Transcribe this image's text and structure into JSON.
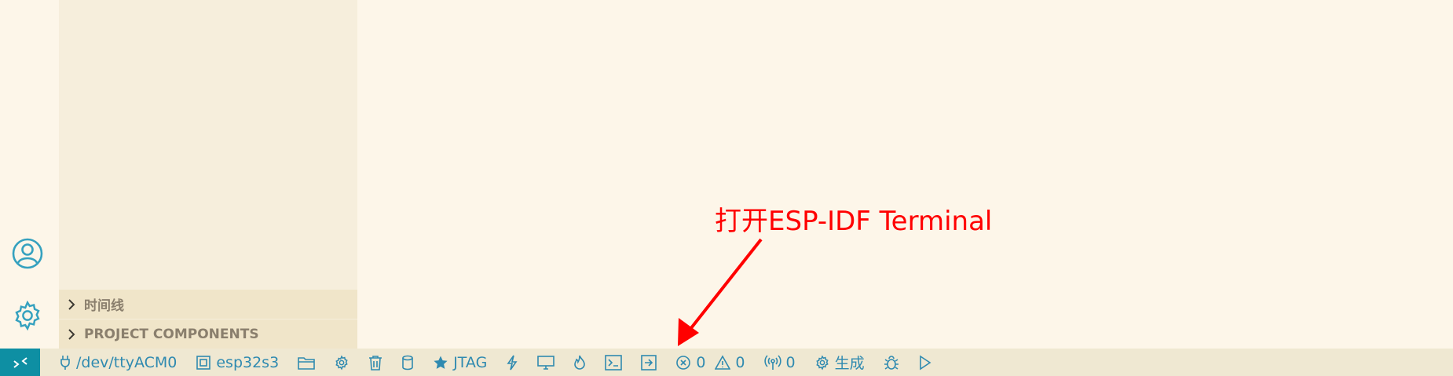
{
  "sidebar": {
    "sections": [
      {
        "label": "时间线",
        "icon": "chevron-right-icon"
      },
      {
        "label": "PROJECT COMPONENTS",
        "icon": "chevron-right-icon"
      }
    ]
  },
  "activity_bar": {
    "icons": [
      "account-icon",
      "gear-icon"
    ]
  },
  "annotation": {
    "text": "打开ESP-IDF Terminal",
    "color": "#ff0000"
  },
  "status_bar": {
    "port": "/dev/ttyACM0",
    "target": "esp32s3",
    "flash_method": "JTAG",
    "errors": "0",
    "warnings": "0",
    "ports_count": "0",
    "build_label": "生成"
  },
  "colors": {
    "remote_button": "#0e8fa3",
    "status_text": "#2f8ab0",
    "background": "#fdf6e9",
    "sidebar": "#f6eedc",
    "section_header": "#f0e5c9"
  }
}
